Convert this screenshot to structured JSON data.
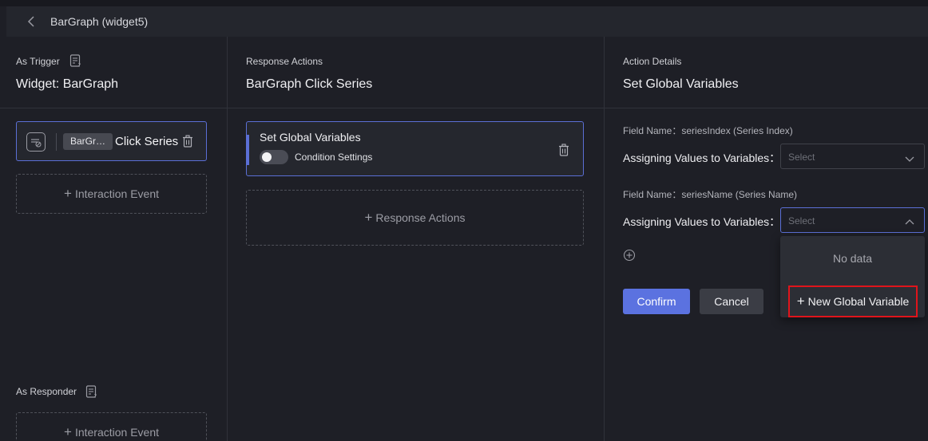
{
  "header": {
    "back_icon": "chevron-left-icon",
    "title": "BarGraph (widget5)"
  },
  "trigger": {
    "label": "As Trigger",
    "widget_title": "Widget: BarGraph",
    "card": {
      "chip": "BarGr…",
      "event": "Click Series"
    },
    "add_event_label": "Interaction Event"
  },
  "responder": {
    "label": "As Responder",
    "add_event_label": "Interaction Event"
  },
  "response": {
    "label": "Response Actions",
    "title": "BarGraph Click Series",
    "action_card": {
      "title": "Set Global Variables",
      "condition_label": "Condition Settings",
      "condition_enabled": false
    },
    "add_action_label": "Response Actions"
  },
  "details": {
    "label": "Action Details",
    "title": "Set Global Variables",
    "fields": [
      {
        "field_name": "Field Name：seriesIndex (Series Index)",
        "assign_label": "Assigning Values to Variables：",
        "placeholder": "Select",
        "open": false
      },
      {
        "field_name": "Field Name：seriesName (Series Name)",
        "assign_label": "Assigning Values to Variables：",
        "placeholder": "Select",
        "open": true
      }
    ],
    "confirm_label": "Confirm",
    "cancel_label": "Cancel"
  },
  "dropdown": {
    "empty_text": "No data",
    "new_variable_label": "New Global Variable"
  },
  "colors": {
    "accent": "#5b72e0",
    "highlight_box": "#e0141b",
    "background": "#1e1f26"
  }
}
